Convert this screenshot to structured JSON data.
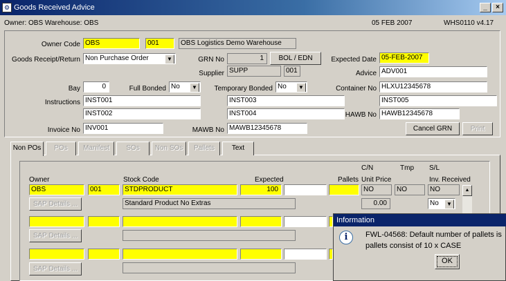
{
  "window": {
    "title": "Goods Received Advice",
    "icon_char": "⚙",
    "min_char": "_",
    "close_char": "×"
  },
  "status": {
    "owner_text": "Owner: OBS   Warehouse: OBS",
    "date": "05 FEB 2007",
    "version": "WHS0110  v4.17"
  },
  "form": {
    "owner_code_label": "Owner Code",
    "owner_code": "OBS",
    "owner_code2": "001",
    "warehouse_name": "OBS Logistics Demo Warehouse",
    "receipt_label": "Goods Receipt/Return",
    "receipt_value": "Non Purchase Order",
    "grn_label": "GRN No",
    "grn_value": "1",
    "bol_button": "BOL / EDN",
    "expected_date_label": "Expected Date",
    "expected_date": "05-FEB-2007",
    "supplier_label": "Supplier",
    "supplier_value": "SUPP",
    "supplier_code": "001",
    "advice_label": "Advice",
    "advice_value": "ADV001",
    "bay_label": "Bay",
    "bay_value": "0",
    "full_bonded_label": "Full Bonded",
    "full_bonded_value": "No",
    "temp_bonded_label": "Temporary Bonded",
    "temp_bonded_value": "No",
    "container_label": "Container No",
    "container_value": "HLXU12345678",
    "instructions_label": "Instructions",
    "inst1": "INST001",
    "inst2": "INST002",
    "inst3": "INST003",
    "inst4": "INST004",
    "inst5": "INST005",
    "hawb_label": "HAWB No",
    "hawb_value": "HAWB12345678",
    "invoice_label": "Invoice No",
    "invoice_value": "INV001",
    "mawb_label": "MAWB No",
    "mawb_value": "MAWB12345678",
    "cancel_button": "Cancel GRN",
    "print_button": "Print"
  },
  "tabs": [
    {
      "label": "Non POs"
    },
    {
      "label": "POs"
    },
    {
      "label": "Manifest"
    },
    {
      "label": "SOs"
    },
    {
      "label": "Non SOs"
    },
    {
      "label": "Pallets"
    },
    {
      "label": "Text"
    }
  ],
  "grid": {
    "col_owner": "Owner",
    "col_stock": "Stock Code",
    "col_expected": "Expected",
    "col_pallets": "Pallets",
    "col_cn": "C/N",
    "col_unit_price": "Unit Price",
    "col_tmp": "Tmp",
    "col_sl": "S/L",
    "col_inv_received": "Inv. Received",
    "row1": {
      "owner": "OBS",
      "owner2": "001",
      "stock": "STDPRODUCT",
      "expected": "100",
      "cn": "NO",
      "tmp": "NO",
      "sl": "NO",
      "description": "Standard Product No Extras",
      "price": "0.00",
      "inv_received": "No"
    },
    "sap_button": "SAP Details ..."
  },
  "dialog": {
    "title": "Information",
    "icon_char": "i",
    "message_line1": "FWL-04568: Default number of pallets is",
    "message_line2": "pallets consist of 10 x CASE",
    "ok_button": "OK"
  }
}
